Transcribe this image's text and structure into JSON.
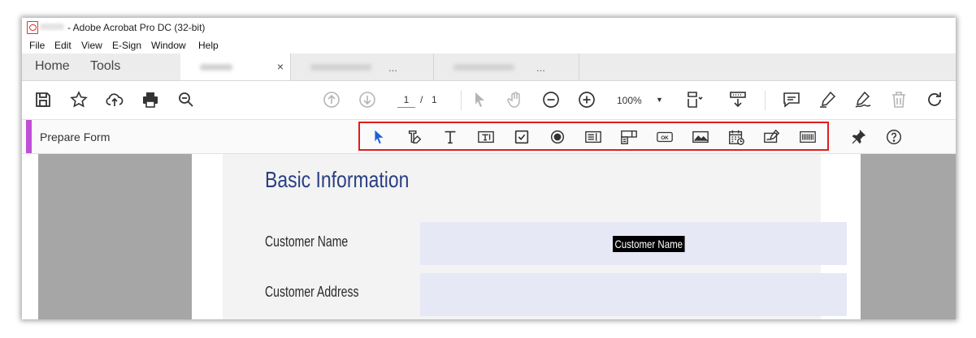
{
  "window": {
    "title": "- Adobe Acrobat Pro DC (32-bit)"
  },
  "menu": [
    "File",
    "Edit",
    "View",
    "E-Sign",
    "Window",
    "Help"
  ],
  "nav_tabs": [
    "Home",
    "Tools"
  ],
  "doc_tabs": {
    "active_close": "×",
    "inactive_suffix": "..."
  },
  "toolbar": {
    "page_current": "1",
    "page_separator": "/",
    "page_total": "1",
    "zoom": "100%",
    "icons": [
      "save-icon",
      "star-icon",
      "cloud-upload-icon",
      "print-icon",
      "search-zoom-icon",
      "page-up-icon",
      "page-down-icon",
      "select-arrow-icon",
      "hand-icon",
      "zoom-out-icon",
      "zoom-in-icon",
      "zoom-dropdown-icon",
      "fit-page-icon",
      "scroll-mode-icon",
      "comment-icon",
      "highlight-pen-icon",
      "sign-icon",
      "delete-icon",
      "rotate-icon"
    ]
  },
  "form_toolbar": {
    "title": "Prepare Form",
    "icons": [
      "select-arrow-icon",
      "text-field-edit-icon",
      "text-icon",
      "text-field-icon",
      "checkbox-icon",
      "radio-button-icon",
      "list-box-icon",
      "dropdown-icon",
      "button-ok-icon",
      "image-field-icon",
      "date-field-icon",
      "signature-field-icon",
      "barcode-icon",
      "pin-icon",
      "help-icon"
    ],
    "ok_label": "OK",
    "accent_color": "#c04fd6",
    "highlight_color": "#e21b1b"
  },
  "document": {
    "section_title": "Basic Information",
    "fields": [
      {
        "label": "Customer Name",
        "value": "Customer Name"
      },
      {
        "label": "Customer Address",
        "value": ""
      }
    ],
    "title_color": "#2a3f82",
    "field_bg": "#e6e8f6"
  }
}
